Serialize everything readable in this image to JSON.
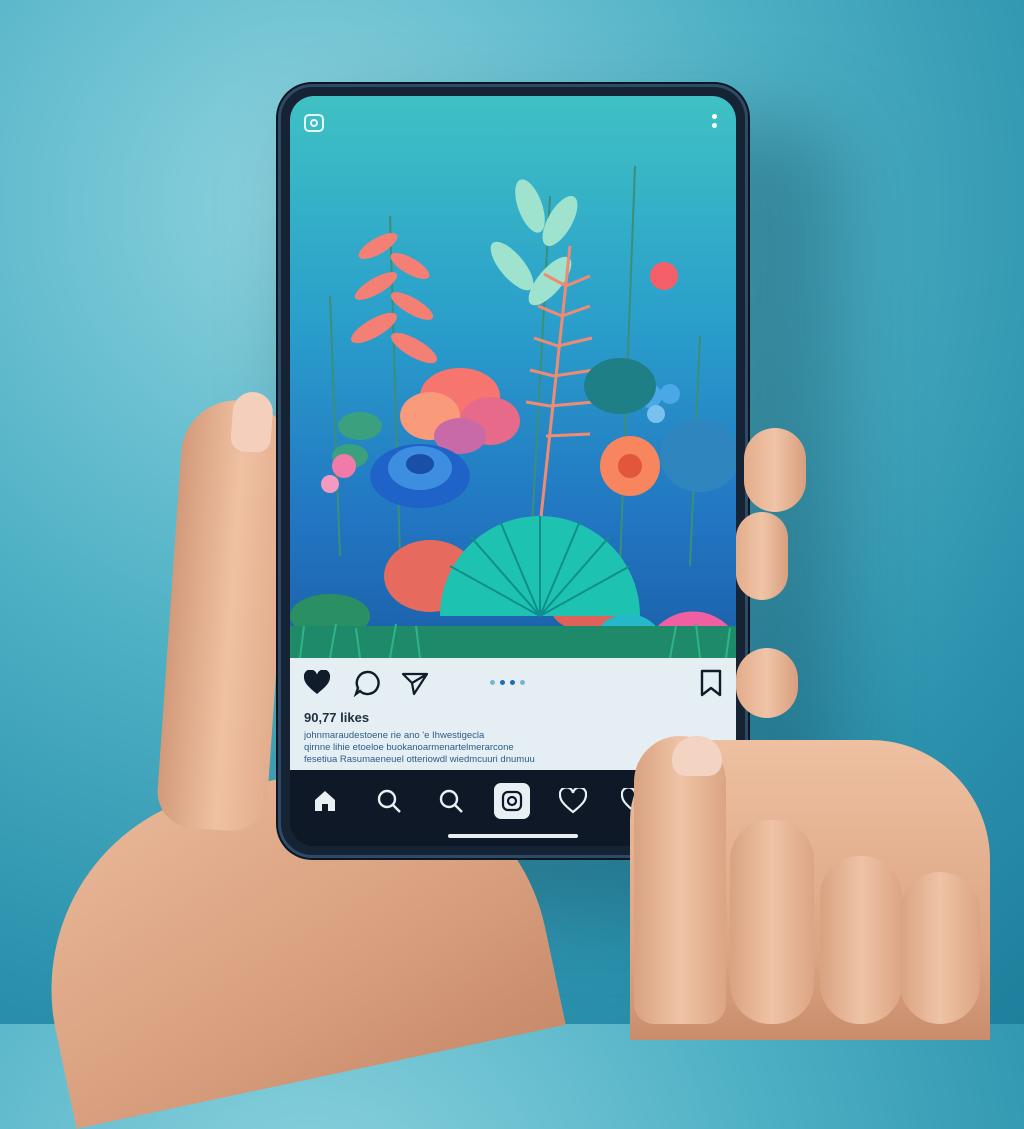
{
  "colors": {
    "background": "#52b3c6",
    "phone_frame": "#152335",
    "post_panel": "#e5eff3",
    "bottom_nav": "#0e1826",
    "accent": "#1b6fb0"
  },
  "status_bar": {
    "left_icon": "instagram-camera-icon",
    "right_icon": "more-vertical-icon"
  },
  "post": {
    "image_icon": "garden-illustration",
    "actions": {
      "like_icon": "heart-icon",
      "comment_icon": "comment-icon",
      "share_icon": "send-icon",
      "save_icon": "bookmark-icon"
    },
    "carousel": {
      "count": 4,
      "active_index": 2
    },
    "likes": "90,77 likes",
    "caption_lines": [
      "johnmaraudestoene rie ano 'e Ihwestigecla",
      "qirnne lihie etoeloe buokanoarmenartelmerarcone",
      "fesetiua Rasumaeneuel otteriowdl wiedmcuuri dnumuu"
    ]
  },
  "bottom_nav": {
    "items": [
      {
        "icon": "home-icon"
      },
      {
        "icon": "search-icon"
      },
      {
        "icon": "search-icon"
      },
      {
        "icon": "reels-icon"
      },
      {
        "icon": "heart-icon"
      },
      {
        "icon": "heart-icon"
      }
    ]
  }
}
